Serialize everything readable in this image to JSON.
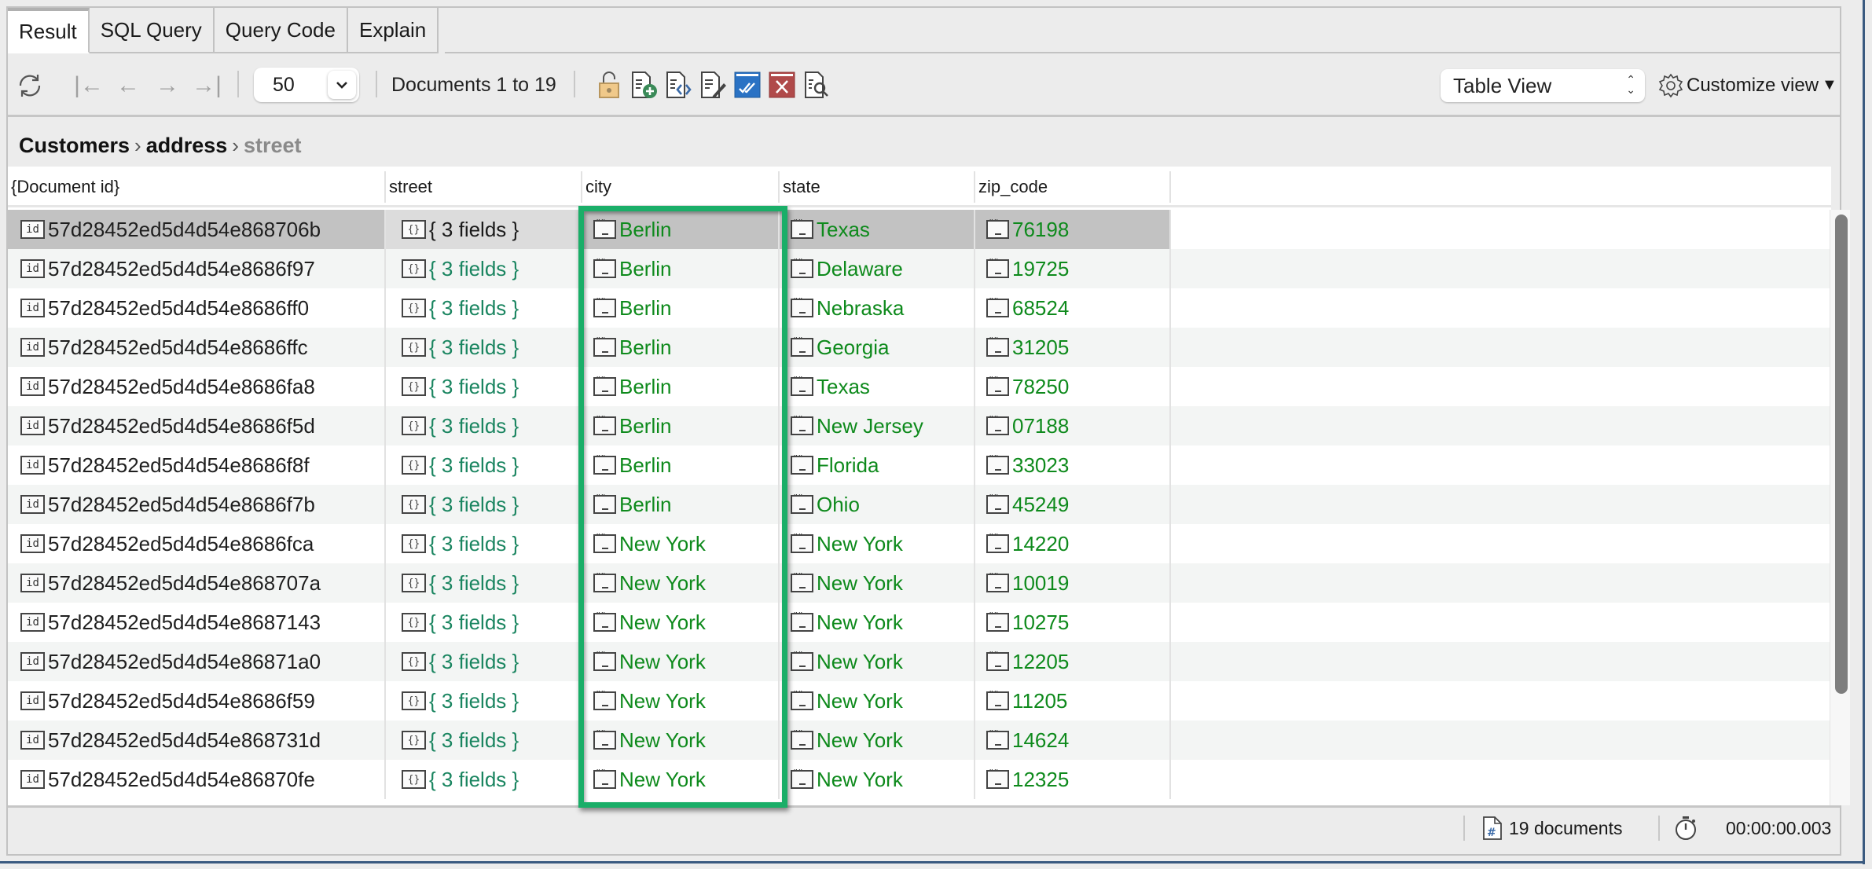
{
  "tabs": [
    {
      "label": "Result",
      "active": true
    },
    {
      "label": "SQL Query",
      "active": false
    },
    {
      "label": "Query Code",
      "active": false
    },
    {
      "label": "Explain",
      "active": false
    }
  ],
  "toolbar": {
    "refresh_icon": "refresh-icon",
    "nav": [
      "first-page-icon",
      "prev-page-icon",
      "next-page-icon",
      "last-page-icon"
    ],
    "page_size": "50",
    "doc_range": "Documents 1 to 19",
    "actions": [
      "unlock-icon",
      "add-document-icon",
      "view-json-icon",
      "edit-document-icon",
      "commit-icon",
      "cancel-icon",
      "search-document-icon"
    ],
    "view_mode": "Table View",
    "customize_label": "Customize view",
    "customize_arrow": "▼"
  },
  "breadcrumb": [
    "Customers",
    "address",
    "street"
  ],
  "table": {
    "columns": [
      "{Document id}",
      "street",
      "city",
      "state",
      "zip_code"
    ],
    "rows": [
      {
        "id": "57d28452ed5d4d54e868706b",
        "street": "{ 3 fields }",
        "city": "Berlin",
        "state": "Texas",
        "zip": "76198"
      },
      {
        "id": "57d28452ed5d4d54e8686f97",
        "street": "{ 3 fields }",
        "city": "Berlin",
        "state": "Delaware",
        "zip": "19725"
      },
      {
        "id": "57d28452ed5d4d54e8686ff0",
        "street": "{ 3 fields }",
        "city": "Berlin",
        "state": "Nebraska",
        "zip": "68524"
      },
      {
        "id": "57d28452ed5d4d54e8686ffc",
        "street": "{ 3 fields }",
        "city": "Berlin",
        "state": "Georgia",
        "zip": "31205"
      },
      {
        "id": "57d28452ed5d4d54e8686fa8",
        "street": "{ 3 fields }",
        "city": "Berlin",
        "state": "Texas",
        "zip": "78250"
      },
      {
        "id": "57d28452ed5d4d54e8686f5d",
        "street": "{ 3 fields }",
        "city": "Berlin",
        "state": "New Jersey",
        "zip": "07188"
      },
      {
        "id": "57d28452ed5d4d54e8686f8f",
        "street": "{ 3 fields }",
        "city": "Berlin",
        "state": "Florida",
        "zip": "33023"
      },
      {
        "id": "57d28452ed5d4d54e8686f7b",
        "street": "{ 3 fields }",
        "city": "Berlin",
        "state": "Ohio",
        "zip": "45249"
      },
      {
        "id": "57d28452ed5d4d54e8686fca",
        "street": "{ 3 fields }",
        "city": "New York",
        "state": "New York",
        "zip": "14220"
      },
      {
        "id": "57d28452ed5d4d54e868707a",
        "street": "{ 3 fields }",
        "city": "New York",
        "state": "New York",
        "zip": "10019"
      },
      {
        "id": "57d28452ed5d4d54e8687143",
        "street": "{ 3 fields }",
        "city": "New York",
        "state": "New York",
        "zip": "10275"
      },
      {
        "id": "57d28452ed5d4d54e86871a0",
        "street": "{ 3 fields }",
        "city": "New York",
        "state": "New York",
        "zip": "12205"
      },
      {
        "id": "57d28452ed5d4d54e8686f59",
        "street": "{ 3 fields }",
        "city": "New York",
        "state": "New York",
        "zip": "11205"
      },
      {
        "id": "57d28452ed5d4d54e868731d",
        "street": "{ 3 fields }",
        "city": "New York",
        "state": "New York",
        "zip": "14624"
      },
      {
        "id": "57d28452ed5d4d54e86870fe",
        "street": "{ 3 fields }",
        "city": "New York",
        "state": "New York",
        "zip": "12325"
      }
    ],
    "selected_row": 0,
    "highlighted_column": "city"
  },
  "status": {
    "doc_count": "19 documents",
    "elapsed": "00:00:00.003"
  },
  "colors": {
    "value_green": "#0e8a1c",
    "object_teal": "#1a8560",
    "highlight": "#1aae68",
    "commit_blue": "#2a72c4",
    "cancel_red": "#b04a4a",
    "lock_tan": "#f0c98a"
  }
}
